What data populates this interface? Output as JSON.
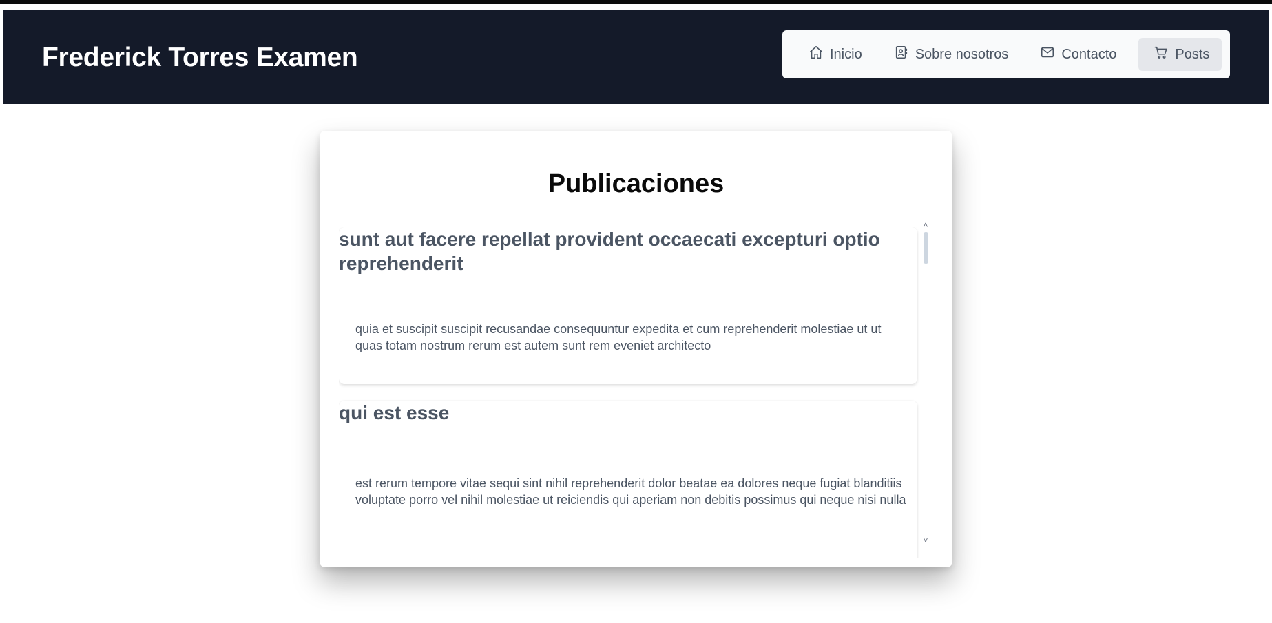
{
  "brand": "Frederick Torres Examen",
  "nav": {
    "items": [
      {
        "label": "Inicio",
        "icon": "home-icon"
      },
      {
        "label": "Sobre nosotros",
        "icon": "contact-book-icon"
      },
      {
        "label": "Contacto",
        "icon": "mail-icon"
      },
      {
        "label": "Posts",
        "icon": "cart-icon",
        "active": true
      }
    ]
  },
  "page": {
    "title": "Publicaciones"
  },
  "posts": [
    {
      "title": "sunt aut facere repellat provident occaecati excepturi optio reprehenderit",
      "body": "quia et suscipit suscipit recusandae consequuntur expedita et cum reprehenderit molestiae ut ut quas totam nostrum rerum est autem sunt rem eveniet architecto"
    },
    {
      "title": "qui est esse",
      "body": "est rerum tempore vitae sequi sint nihil reprehenderit dolor beatae ea dolores neque fugiat blanditiis voluptate porro vel nihil molestiae ut reiciendis qui aperiam non debitis possimus qui neque nisi nulla"
    }
  ],
  "colors": {
    "header_bg": "#141a29",
    "nav_bg": "#f9fafb",
    "nav_active_bg": "#e5e7eb",
    "text_muted": "#4b5563"
  }
}
